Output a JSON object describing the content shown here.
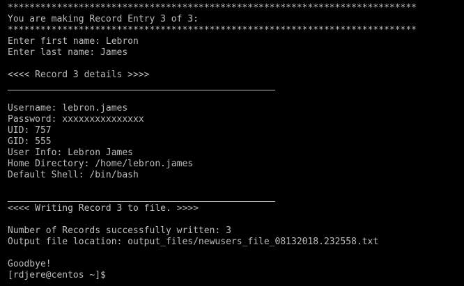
{
  "terminal": {
    "colors": {
      "background": "#000000",
      "foreground": "#bdbdbd"
    },
    "banner_top": "***************************************************************************",
    "heading": "You are making Record Entry 3 of 3:",
    "banner_bottom": "***************************************************************************",
    "first_name_prompt": "Enter first name: Lebron",
    "last_name_prompt": "Enter last name: James",
    "record_header": "<<<< Record 3 details >>>>",
    "details": {
      "username": "Username: lebron.james",
      "password": "Password: xxxxxxxxxxxxxxx",
      "uid": "UID: 757",
      "gid": "GID: 555",
      "user_info": "User Info: Lebron James",
      "home_directory": "Home Directory: /home/lebron.james",
      "default_shell": "Default Shell: /bin/bash"
    },
    "writing_status": "<<<< Writing Record 3 to file. >>>>",
    "records_written": "Number of Records successfully written: 3",
    "output_file": "Output file location: output_files/newusers_file_08132018.232558.txt",
    "goodbye": "Goodbye!",
    "shell_prompt": "[rdjere@centos ~]$"
  }
}
